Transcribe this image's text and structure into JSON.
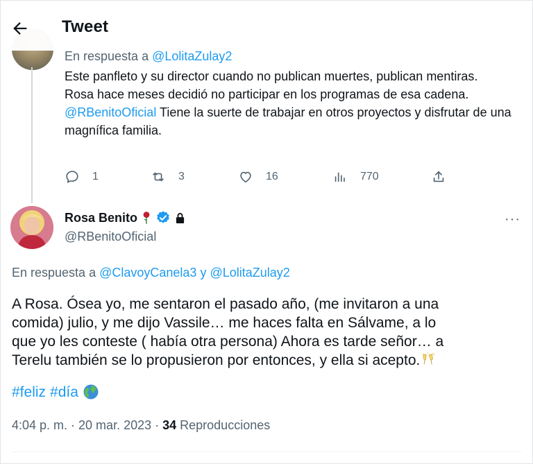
{
  "header": {
    "title": "Tweet",
    "back_icon": "arrow-left-icon"
  },
  "parent_tweet": {
    "reply_prefix": "En respuesta a",
    "reply_to": "@LolitaZulay2",
    "lines": [
      "Este panfleto y su director cuando no publican muertes, publican mentiras.",
      "Rosa hace meses decidió no participar en los programas de esa cadena."
    ],
    "mention": "@RBenitoOficial",
    "line3_rest": " Tiene la suerte de trabajar en otros proyectos y disfrutar de una magnífica familia.",
    "actions": {
      "replies": "1",
      "retweets": "3",
      "likes": "16",
      "views": "770"
    }
  },
  "main_tweet": {
    "author_name": "Rosa Benito",
    "author_handle": "@RBenitoOficial",
    "more_label": "···",
    "reply_prefix": "En respuesta a",
    "reply_to_1": "@ClavoyCanela3",
    "reply_joiner": " y ",
    "reply_to_2": "@LolitaZulay2",
    "text": "A Rosa. Ósea yo, me sentaron el pasado año, (me invitaron a una comida) julio, y me dijo Vassile… me haces falta en Sálvame, a lo que yo les conteste ( había otra persona) Ahora es tarde señor… a Terelu también se lo propusieron por entonces, y ella si acepto.",
    "hashtag_1": "#feliz",
    "hashtag_2": "#día",
    "time": "4:04 p. m. · 20 mar. 2023 · ",
    "views_count": "34",
    "views_label": " Reproducciones"
  },
  "colors": {
    "link": "#1d9bf0",
    "secondary_text": "#536471",
    "primary_text": "#0f1419",
    "verified": "#1d9bf0"
  }
}
